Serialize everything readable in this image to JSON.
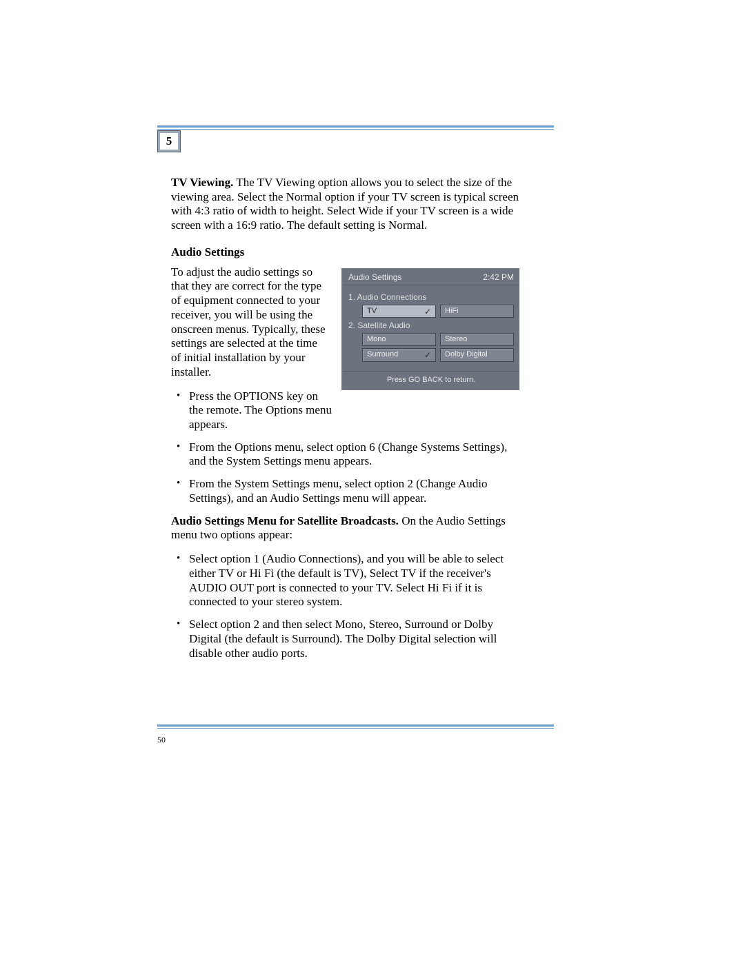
{
  "chapter_number": "5",
  "page_number": "50",
  "tv_viewing": {
    "heading": "TV Viewing.",
    "text": " The TV Viewing option allows you to select the size of the viewing area. Select the Normal option if your TV screen is typical screen with 4:3 ratio of width to height. Select Wide if your TV screen is a wide screen with a 16:9 ratio. The default setting is Normal."
  },
  "audio_heading": "Audio Settings",
  "audio_intro": "To adjust the audio settings so that they are correct for the type of equipment connected to your receiver, you will be using the onscreen menus. Typically, these settings are selected at the time of initial installation by your installer.",
  "bullets_top": [
    "Press the OPTIONS key on the remote. The Options menu appears.",
    "From the Options menu, select option 6 (Change Systems Settings), and the System Settings menu appears.",
    "From the System Settings menu, select option 2 (Change Audio Settings), and an Audio Settings menu will appear."
  ],
  "sat_heading": "Audio Settings Menu for Satellite Broadcasts.",
  "sat_intro": " On the Audio Settings menu two options appear:",
  "bullets_sat": [
    "Select option 1 (Audio Connections), and you will be able to select either TV or Hi Fi (the default is TV), Select TV if the receiver's AUDIO OUT port is connected to your TV. Select Hi Fi if it is connected to your stereo system.",
    "Select option 2 and then select Mono, Stereo, Surround or Dolby Digital (the default is Surround). The Dolby Digital selection will disable other audio ports."
  ],
  "osd": {
    "title": "Audio Settings",
    "time": "2:42 PM",
    "section1": "1.  Audio Connections",
    "row1": {
      "a": "TV",
      "b": "HiFi"
    },
    "section2": "2.  Satellite Audio",
    "row2": {
      "a": "Mono",
      "b": "Stereo"
    },
    "row3": {
      "a": "Surround",
      "b": "Dolby Digital"
    },
    "footer": "Press GO BACK to return."
  }
}
